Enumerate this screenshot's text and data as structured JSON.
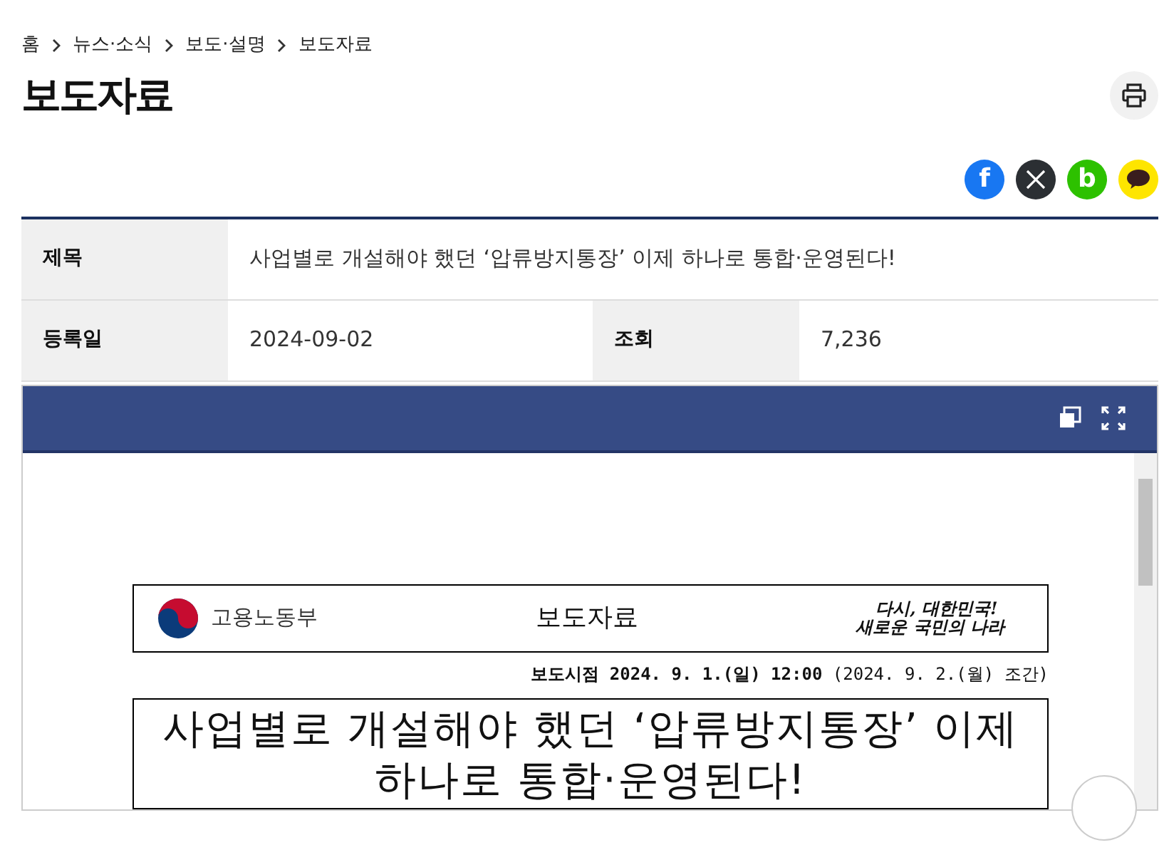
{
  "breadcrumb": [
    {
      "label": "홈"
    },
    {
      "label": "뉴스·소식"
    },
    {
      "label": "보도·설명"
    },
    {
      "label": "보도자료"
    }
  ],
  "page_title": "보도자료",
  "share": [
    {
      "kind": "letter",
      "glyph": "f",
      "color": "#1877f2"
    },
    {
      "kind": "x",
      "color": "#2b2f33"
    },
    {
      "kind": "letter",
      "glyph": "b",
      "color": "#2dc100"
    },
    {
      "kind": "bubble",
      "color": "#fee500"
    }
  ],
  "info_rows": [
    [
      {
        "label": "제목",
        "value": "사업별로 개설해야 했던 ‘압류방지통장’ 이제 하나로 통합·운영된다!"
      }
    ],
    [
      {
        "label": "등록일",
        "value": "2024-09-02"
      },
      {
        "label": "조회",
        "value": "7,236"
      }
    ]
  ],
  "document": {
    "ministry": "고용노동부",
    "doc_type": "보도자료",
    "slogan": [
      "다시, 대한민국!",
      "새로운 국민의 나라"
    ],
    "release": "**보도시점 2024. 9. 1.(일) 12:00** (2024. 9. 2.(월) 조간)",
    "headline": "사업별로 개설해야 했던 ‘압류방지통장’ 이제 하나로 통합·운영된다!"
  }
}
